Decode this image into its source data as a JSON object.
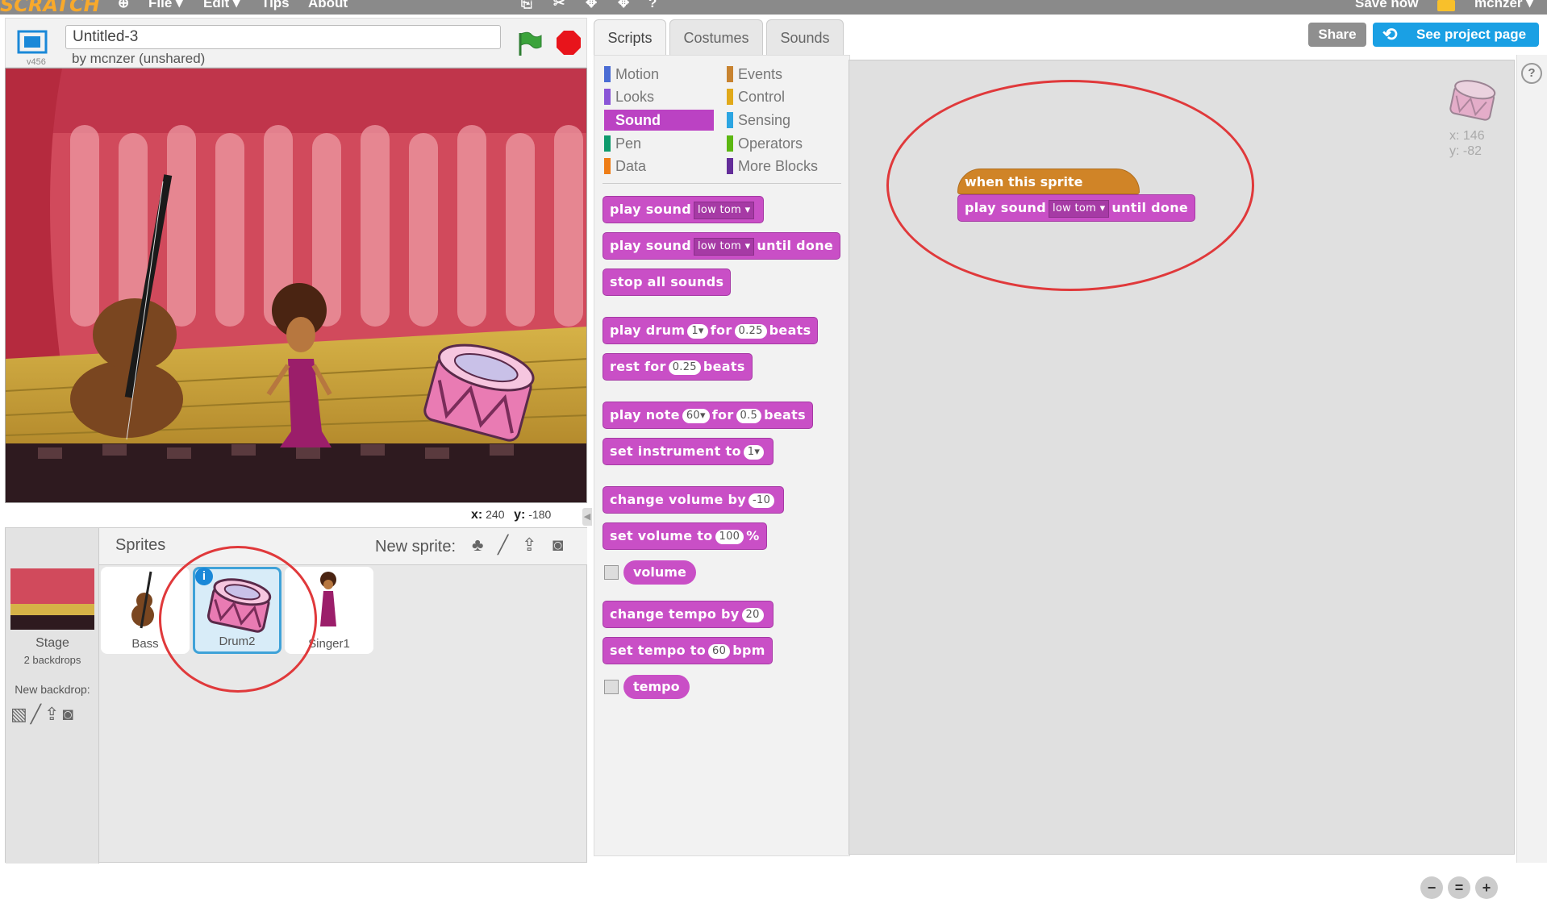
{
  "menubar": {
    "logo": "SCRATCH",
    "items": [
      "File ▾",
      "Edit ▾",
      "Tips",
      "About"
    ],
    "save_now": "Save now",
    "user": "mcnzer ▾"
  },
  "project": {
    "title": "Untitled-3",
    "byline": "by mcnzer (unshared)",
    "version": "v456"
  },
  "stage": {
    "coords": {
      "x_label": "x:",
      "x": "240",
      "y_label": "y:",
      "y": "-180"
    }
  },
  "sprites_pane": {
    "title": "Sprites",
    "new_sprite_label": "New sprite:",
    "stage_label": "Stage",
    "stage_backdrops": "2 backdrops",
    "new_backdrop_label": "New backdrop:",
    "sprites": [
      {
        "name": "Bass"
      },
      {
        "name": "Drum2"
      },
      {
        "name": "Singer1"
      }
    ]
  },
  "tabs": [
    "Scripts",
    "Costumes",
    "Sounds"
  ],
  "categories": {
    "left": [
      {
        "label": "Motion",
        "color": "#4a6cd4"
      },
      {
        "label": "Looks",
        "color": "#8a55d7"
      },
      {
        "label": "Sound",
        "color": "#bb42c3"
      },
      {
        "label": "Pen",
        "color": "#0e9a6c"
      },
      {
        "label": "Data",
        "color": "#ee7d16"
      }
    ],
    "right": [
      {
        "label": "Events",
        "color": "#c88330"
      },
      {
        "label": "Control",
        "color": "#e1a91a"
      },
      {
        "label": "Sensing",
        "color": "#2ca5e2"
      },
      {
        "label": "Operators",
        "color": "#5cb712"
      },
      {
        "label": "More Blocks",
        "color": "#632d99"
      }
    ]
  },
  "blocks": {
    "play_sound": {
      "a": "play sound",
      "sound": "low tom ▾"
    },
    "play_sound_until": {
      "a": "play sound",
      "sound": "low tom ▾",
      "b": "until done"
    },
    "stop_all": "stop all sounds",
    "play_drum": {
      "a": "play drum",
      "drum": "1▾",
      "b": "for",
      "beats": "0.25",
      "c": "beats"
    },
    "rest": {
      "a": "rest for",
      "beats": "0.25",
      "b": "beats"
    },
    "play_note": {
      "a": "play note",
      "note": "60▾",
      "b": "for",
      "beats": "0.5",
      "c": "beats"
    },
    "set_instrument": {
      "a": "set instrument to",
      "val": "1▾"
    },
    "change_volume": {
      "a": "change volume by",
      "val": "-10"
    },
    "set_volume": {
      "a": "set volume to",
      "val": "100",
      "b": "%"
    },
    "volume": "volume",
    "change_tempo": {
      "a": "change tempo by",
      "val": "20"
    },
    "set_tempo": {
      "a": "set tempo to",
      "val": "60",
      "b": "bpm"
    },
    "tempo": "tempo"
  },
  "script": {
    "hat": "when this sprite clicked",
    "cmd": {
      "a": "play sound",
      "sound": "low tom ▾",
      "b": "until done"
    }
  },
  "sprite_info": {
    "x": "x: 146",
    "y": "y: -82"
  },
  "buttons": {
    "share": "Share",
    "project_page": "See project page"
  },
  "help": "?",
  "zoom": [
    "−",
    "=",
    "+"
  ],
  "colors": {
    "sound": "#bb42c3",
    "events": "#d08427",
    "highlight": "#e0393b",
    "accent": "#1aa0e4"
  }
}
